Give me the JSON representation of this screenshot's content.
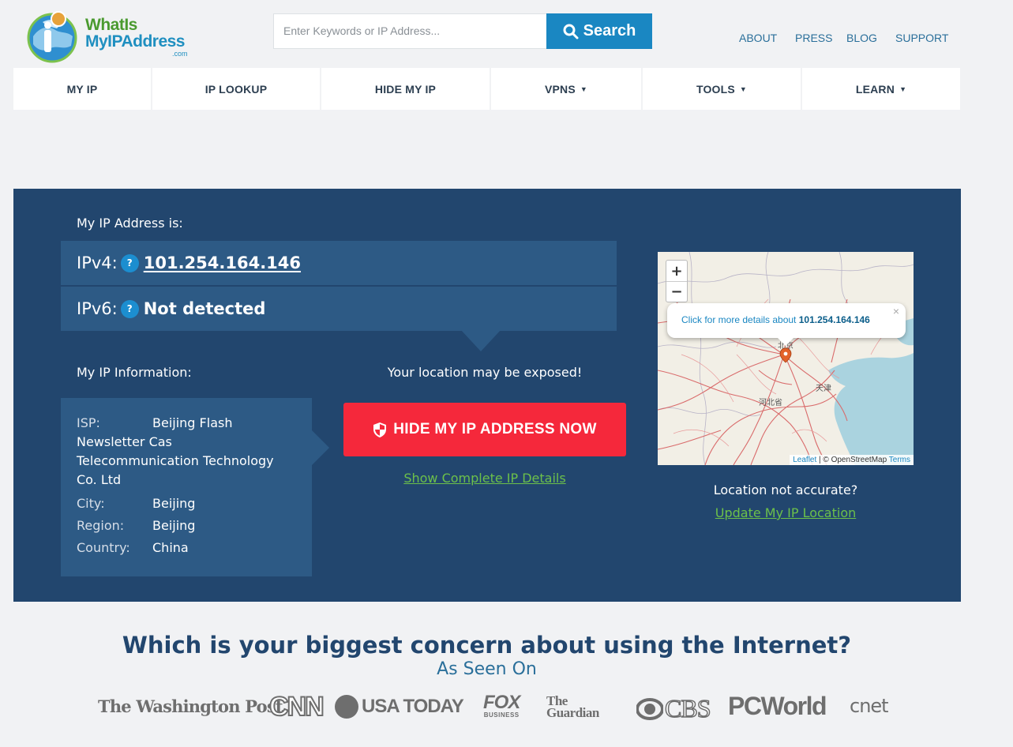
{
  "header": {
    "logo": {
      "line1": "WhatIs",
      "line2": "MyIPAddress",
      "line3": ".com"
    },
    "search": {
      "placeholder": "Enter Keywords or IP Address...",
      "button_label": "Search"
    },
    "top_links": [
      "ABOUT",
      "PRESS",
      "BLOG",
      "SUPPORT"
    ]
  },
  "nav": {
    "items": [
      {
        "label": "MY IP",
        "dropdown": false
      },
      {
        "label": "IP LOOKUP",
        "dropdown": false
      },
      {
        "label": "HIDE MY IP",
        "dropdown": false
      },
      {
        "label": "VPNS",
        "dropdown": true
      },
      {
        "label": "TOOLS",
        "dropdown": true
      },
      {
        "label": "LEARN",
        "dropdown": true
      }
    ],
    "caret": "▼"
  },
  "ip": {
    "heading": "My IP Address is:",
    "ipv4_label": "IPv4:",
    "ipv4_value": "101.254.164.146",
    "ipv6_label": "IPv6:",
    "ipv6_value": "Not detected",
    "help_glyph": "?"
  },
  "info": {
    "heading": "My IP Information:",
    "isp_label": "ISP:",
    "isp_value_first": "Beijing Flash",
    "isp_value_rest": "Newsletter Cas Telecommunication Technology Co. Ltd",
    "rows": [
      {
        "label": "City:",
        "value": "Beijing"
      },
      {
        "label": "Region:",
        "value": "Beijing"
      },
      {
        "label": "Country:",
        "value": "China"
      }
    ]
  },
  "cta": {
    "warning": "Your location may be exposed!",
    "button_label": "HIDE MY IP ADDRESS NOW",
    "details_link": "Show Complete IP Details"
  },
  "map": {
    "zoom_in": "+",
    "zoom_out": "−",
    "popup_text": "Click for more details about",
    "popup_ip": "101.254.164.146",
    "popup_close": "×",
    "labels": {
      "city": "北京",
      "tianjin": "天津",
      "hebei": "河北省"
    },
    "attribution": {
      "leaflet": "Leaflet",
      "sep": " | © OpenStreetMap ",
      "terms": "Terms"
    }
  },
  "location": {
    "question": "Location not accurate?",
    "link": "Update My IP Location"
  },
  "bottom": {
    "concern": "Which is your biggest concern about using the Internet?",
    "as_seen_on": "As Seen On",
    "press": [
      "The Washington Post",
      "CNN",
      "USA TODAY",
      "FOX",
      "BUSINESS",
      "The Guardian",
      "CBS",
      "PCWorld",
      "cnet"
    ]
  },
  "colors": {
    "panel": "#22466e",
    "panel_row": "#2d5a85",
    "accent_blue": "#1a87c2",
    "cta_red": "#f5283b",
    "link_green": "#6cc04a"
  }
}
